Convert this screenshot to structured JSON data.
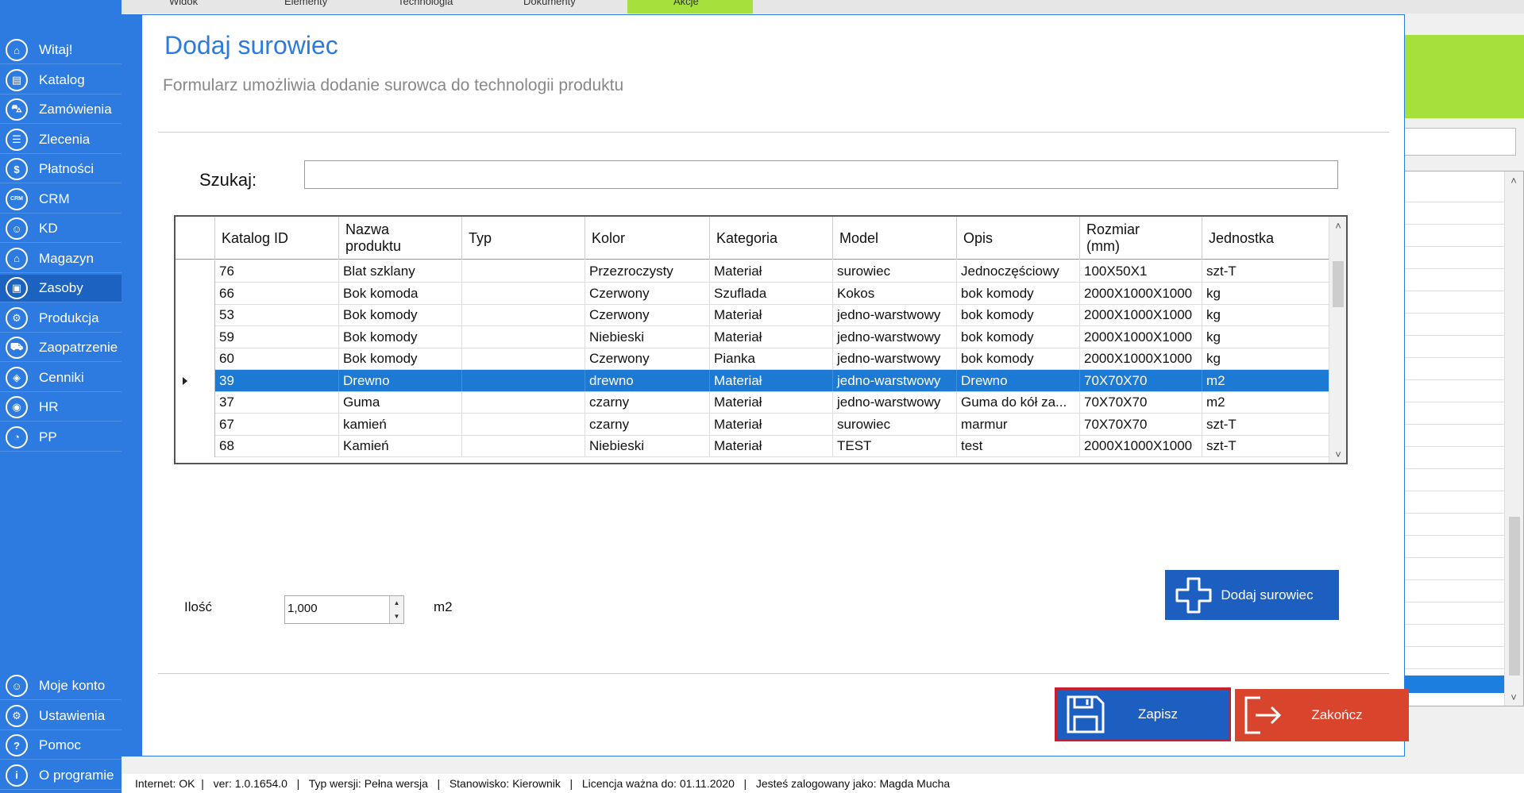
{
  "sidebar": {
    "top_items": [
      {
        "label": "Witaj!",
        "icon": "home-icon",
        "glyph": "⌂"
      },
      {
        "label": "Katalog",
        "icon": "book-icon",
        "glyph": "▤"
      },
      {
        "label": "Zamówienia",
        "icon": "cart-icon",
        "glyph": "⛍"
      },
      {
        "label": "Zlecenia",
        "icon": "list-icon",
        "glyph": "☰"
      },
      {
        "label": "Płatności",
        "icon": "dollar-icon",
        "glyph": "$"
      },
      {
        "label": "CRM",
        "icon": "crm-icon",
        "glyph": "CRM"
      },
      {
        "label": "KD",
        "icon": "user-icon",
        "glyph": "☺"
      },
      {
        "label": "Magazyn",
        "icon": "warehouse-icon",
        "glyph": "⌂"
      },
      {
        "label": "Zasoby",
        "icon": "resources-icon",
        "glyph": "▣",
        "active": true
      },
      {
        "label": "Produkcja",
        "icon": "factory-icon",
        "glyph": "⚙"
      },
      {
        "label": "Zaopatrzenie",
        "icon": "truck-icon",
        "glyph": "⛟"
      },
      {
        "label": "Cenniki",
        "icon": "tag-icon",
        "glyph": "◈"
      },
      {
        "label": "HR",
        "icon": "hr-icon",
        "glyph": "◉"
      },
      {
        "label": "PP",
        "icon": "chart-icon",
        "glyph": "◔"
      }
    ],
    "bottom_items": [
      {
        "label": "Moje konto",
        "icon": "account-icon",
        "glyph": "☺"
      },
      {
        "label": "Ustawienia",
        "icon": "settings-icon",
        "glyph": "⚙"
      },
      {
        "label": "Pomoc",
        "icon": "help-icon",
        "glyph": "?"
      },
      {
        "label": "O programie",
        "icon": "info-icon",
        "glyph": "i"
      }
    ]
  },
  "background_tabs": [
    "Widok",
    "Elementy",
    "Technologia",
    "Dokumenty",
    "Akcje"
  ],
  "modal": {
    "title": "Dodaj surowiec",
    "subtitle": "Formularz umożliwia dodanie surowca do technologii produktu",
    "search_label": "Szukaj:",
    "search_value": "",
    "grid": {
      "columns": [
        "Katalog ID",
        "Nazwa\nproduktu",
        "Typ",
        "Kolor",
        "Kategoria",
        "Model",
        "Opis",
        "Rozmiar\n(mm)",
        "Jednostka"
      ],
      "rows": [
        {
          "cells": [
            "76",
            "Blat szklany",
            "",
            "Przezroczysty",
            "Materiał",
            "surowiec",
            "Jednoczęściowy",
            "100X50X1",
            "szt-T"
          ]
        },
        {
          "cells": [
            "66",
            "Bok komoda",
            "",
            "Czerwony",
            "Szuflada",
            "Kokos",
            "bok komody",
            "2000X1000X1000",
            "kg"
          ]
        },
        {
          "cells": [
            "53",
            "Bok komody",
            "",
            "Czerwony",
            "Materiał",
            "jedno-warstwowy",
            "bok komody",
            "2000X1000X1000",
            "kg"
          ]
        },
        {
          "cells": [
            "59",
            "Bok komody",
            "",
            "Niebieski",
            "Materiał",
            "jedno-warstwowy",
            "bok komody",
            "2000X1000X1000",
            "kg"
          ]
        },
        {
          "cells": [
            "60",
            "Bok komody",
            "",
            "Czerwony",
            "Pianka",
            "jedno-warstwowy",
            "bok komody",
            "2000X1000X1000",
            "kg"
          ]
        },
        {
          "cells": [
            "39",
            "Drewno",
            "",
            "drewno",
            "Materiał",
            "jedno-warstwowy",
            "Drewno",
            "70X70X70",
            "m2"
          ],
          "selected": true
        },
        {
          "cells": [
            "37",
            "Guma",
            "",
            "czarny",
            "Materiał",
            "jedno-warstwowy",
            "Guma do kół za...",
            "70X70X70",
            "m2"
          ]
        },
        {
          "cells": [
            "67",
            "kamień",
            "",
            "czarny",
            "Materiał",
            "surowiec",
            "marmur",
            "70X70X70",
            "szt-T"
          ]
        },
        {
          "cells": [
            "68",
            "Kamień",
            "",
            "Niebieski",
            "Materiał",
            "TEST",
            "test",
            "2000X1000X1000",
            "szt-T"
          ]
        }
      ]
    },
    "quantity_label": "Ilość",
    "quantity_value": "1,000",
    "quantity_unit": "m2",
    "add_button": "Dodaj surowiec",
    "save_button": "Zapisz",
    "close_button": "Zakończ"
  },
  "statusbar": {
    "text": "Internet: OK  |   ver: 1.0.1654.0   |   Typ wersji: Pełna wersja   |   Stanowisko: Kierownik   |   Licencja ważna do: 01.11.2020   |   Jesteś zalogowany jako: Magda Mucha"
  },
  "colors": {
    "sidebar": "#2d7be0",
    "accent_green": "#a6e03d",
    "selected_row": "#1c7ad4",
    "button_blue": "#1c5fc0",
    "button_red": "#d9452c"
  }
}
